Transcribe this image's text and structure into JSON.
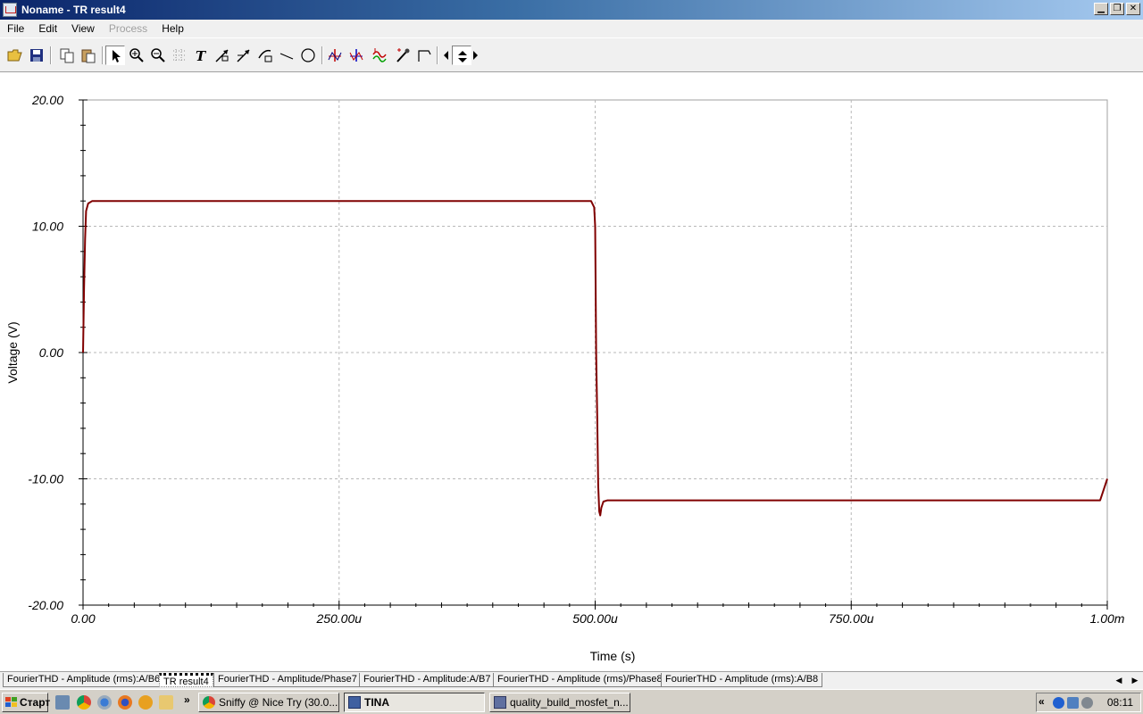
{
  "window": {
    "title": "Noname - TR result4"
  },
  "menu": [
    "File",
    "Edit",
    "View",
    "Process",
    "Help"
  ],
  "menu_disabled": [
    "Process"
  ],
  "toolbar_icons": [
    "open-icon",
    "save-icon",
    "copy-icon",
    "paste-icon",
    "pointer-icon",
    "zoom-in-icon",
    "zoom-out-icon",
    "grid-icon",
    "text-icon",
    "arrow-line-icon",
    "arrow-line-2-icon",
    "arrow-box-icon",
    "line-icon",
    "circle-icon",
    "cursor-a-icon",
    "cursor-b-icon",
    "curve-icon",
    "marker-icon",
    "axis-icon",
    "scroll-left-icon",
    "scroll-updown-icon",
    "scroll-right-icon"
  ],
  "chart_data": {
    "type": "line",
    "xlabel": "Time (s)",
    "ylabel": "Voltage (V)",
    "xlim": [
      0,
      0.001
    ],
    "ylim": [
      -20,
      20
    ],
    "x_ticks": [
      "0.00",
      "250.00u",
      "500.00u",
      "750.00u",
      "1.00m"
    ],
    "y_ticks": [
      "20.00",
      "10.00",
      "0.00",
      "-10.00",
      "-20.00"
    ],
    "grid": true,
    "line_color": "#800000",
    "series": [
      {
        "x": [
          0,
          1e-06,
          2e-06,
          3e-06,
          5e-06,
          9e-06,
          0.000496,
          0.000499,
          0.0005,
          0.000501,
          0.000502,
          0.000503,
          0.000504,
          0.000505,
          0.000506,
          0.000508,
          0.000512,
          0.000993,
          0.001
        ],
        "y": [
          0,
          5,
          9,
          11.2,
          11.8,
          12,
          12,
          11.5,
          10,
          0,
          -5,
          -10.5,
          -12.6,
          -12.9,
          -12.3,
          -11.8,
          -11.7,
          -11.7,
          -10
        ]
      }
    ]
  },
  "tabs": [
    "FourierTHD - Amplitude (rms):A/B6",
    "TR result4",
    "FourierTHD - Amplitude/Phase7",
    "FourierTHD - Amplitude:A/B7",
    "FourierTHD - Amplitude (rms)/Phase8",
    "FourierTHD - Amplitude (rms):A/B8"
  ],
  "active_tab": "TR result4",
  "taskbar": {
    "start_label": "Старт",
    "tasks": [
      "Sniffy @ Nice Try (30.0...",
      "TINA",
      "quality_build_mosfet_n..."
    ],
    "active_task": "TINA",
    "clock": "08:11"
  }
}
